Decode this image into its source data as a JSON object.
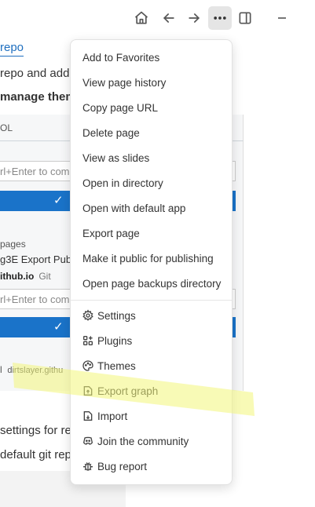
{
  "toolbar": {
    "home_icon": "home-icon",
    "back_icon": "arrow-left-icon",
    "forward_icon": "arrow-right-icon",
    "more_icon": "more-horizontal-icon",
    "sidebar_icon": "sidebar-toggle-icon",
    "minimize_icon": "minimize-icon"
  },
  "background": {
    "link_text": "repo",
    "line1": "repo and add it",
    "line2": "manage them wi",
    "panel_header": "OL",
    "input1": "rl+Enter to com",
    "pages_label": "pages",
    "pages_item": "g3E Export Publ",
    "repo_name": "ithub.io",
    "repo_tag": "Git",
    "input2": "rl+Enter to com",
    "repo_url_prefix": "l",
    "repo_url": "dirtslayer.githu",
    "line3": "settings for rep",
    "line4": "default git rep"
  },
  "menu": {
    "items": [
      {
        "label": "Add to Favorites"
      },
      {
        "label": "View page history"
      },
      {
        "label": "Copy page URL"
      },
      {
        "label": "Delete page"
      },
      {
        "label": "View as slides"
      },
      {
        "label": "Open in directory"
      },
      {
        "label": "Open with default app"
      },
      {
        "label": "Export page"
      },
      {
        "label": "Make it public for publishing"
      },
      {
        "label": "Open page backups directory"
      }
    ],
    "icon_items": [
      {
        "label": "Settings",
        "icon": "gear-icon"
      },
      {
        "label": "Plugins",
        "icon": "plugins-icon"
      },
      {
        "label": "Themes",
        "icon": "palette-icon"
      },
      {
        "label": "Export graph",
        "icon": "export-icon"
      },
      {
        "label": "Import",
        "icon": "import-icon"
      },
      {
        "label": "Join the community",
        "icon": "discord-icon"
      },
      {
        "label": "Bug report",
        "icon": "bug-icon"
      }
    ]
  },
  "colors": {
    "accent": "#1a73c9",
    "highlight": "#f3f57a"
  }
}
